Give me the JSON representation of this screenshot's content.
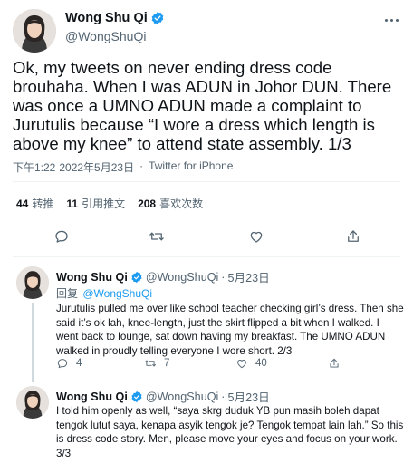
{
  "main_tweet": {
    "name": "Wong Shu Qi",
    "handle": "@WongShuQi",
    "text": "Ok, my tweets on never ending dress code brouhaha. When I was ADUN in Johor DUN. There was once a UMNO ADUN made a complaint to Jurutulis because “I wore a dress which length is above my knee” to attend state assembly. 1/3",
    "time": "下午1:22",
    "date": "2022年5月23日",
    "separator": "·",
    "source": "Twitter for iPhone",
    "stats": [
      {
        "count": "44",
        "label": "转推"
      },
      {
        "count": "11",
        "label": "引用推文"
      },
      {
        "count": "208",
        "label": "喜欢次数"
      }
    ]
  },
  "replies": [
    {
      "name": "Wong Shu Qi",
      "handle": "@WongShuQi",
      "dot": "·",
      "date": "5月23日",
      "reply_prefix": "回复",
      "reply_to": "@WongShuQi",
      "text": "Jurutulis pulled me over like school teacher checking girl’s dress. Then she said it’s ok lah, knee-length, just the skirt flipped a bit when I walked. I went back to lounge, sat down having my breakfast. The UMNO ADUN walked in proudly telling everyone I wore short. 2/3",
      "replies_count": "4",
      "retweets_count": "7",
      "likes_count": "40"
    },
    {
      "name": "Wong Shu Qi",
      "handle": "@WongShuQi",
      "dot": "·",
      "date": "5月23日",
      "text": "I told him openly as well, “saya skrg duduk YB pun masih boleh dapat tengok lutut saya, kenapa asyik tengok je? Tengok tempat lain lah.” So this is dress code story. Men, please move your eyes and focus on your work. 3/3"
    }
  ],
  "colors": {
    "verified": "#1d9bf0",
    "text": "#0f1419",
    "secondary": "#536471",
    "divider": "#eff3f4",
    "link": "#1d9bf0"
  },
  "icons": [
    "verified-badge-icon",
    "more-icon",
    "reply-icon",
    "retweet-icon",
    "like-icon",
    "share-icon"
  ]
}
